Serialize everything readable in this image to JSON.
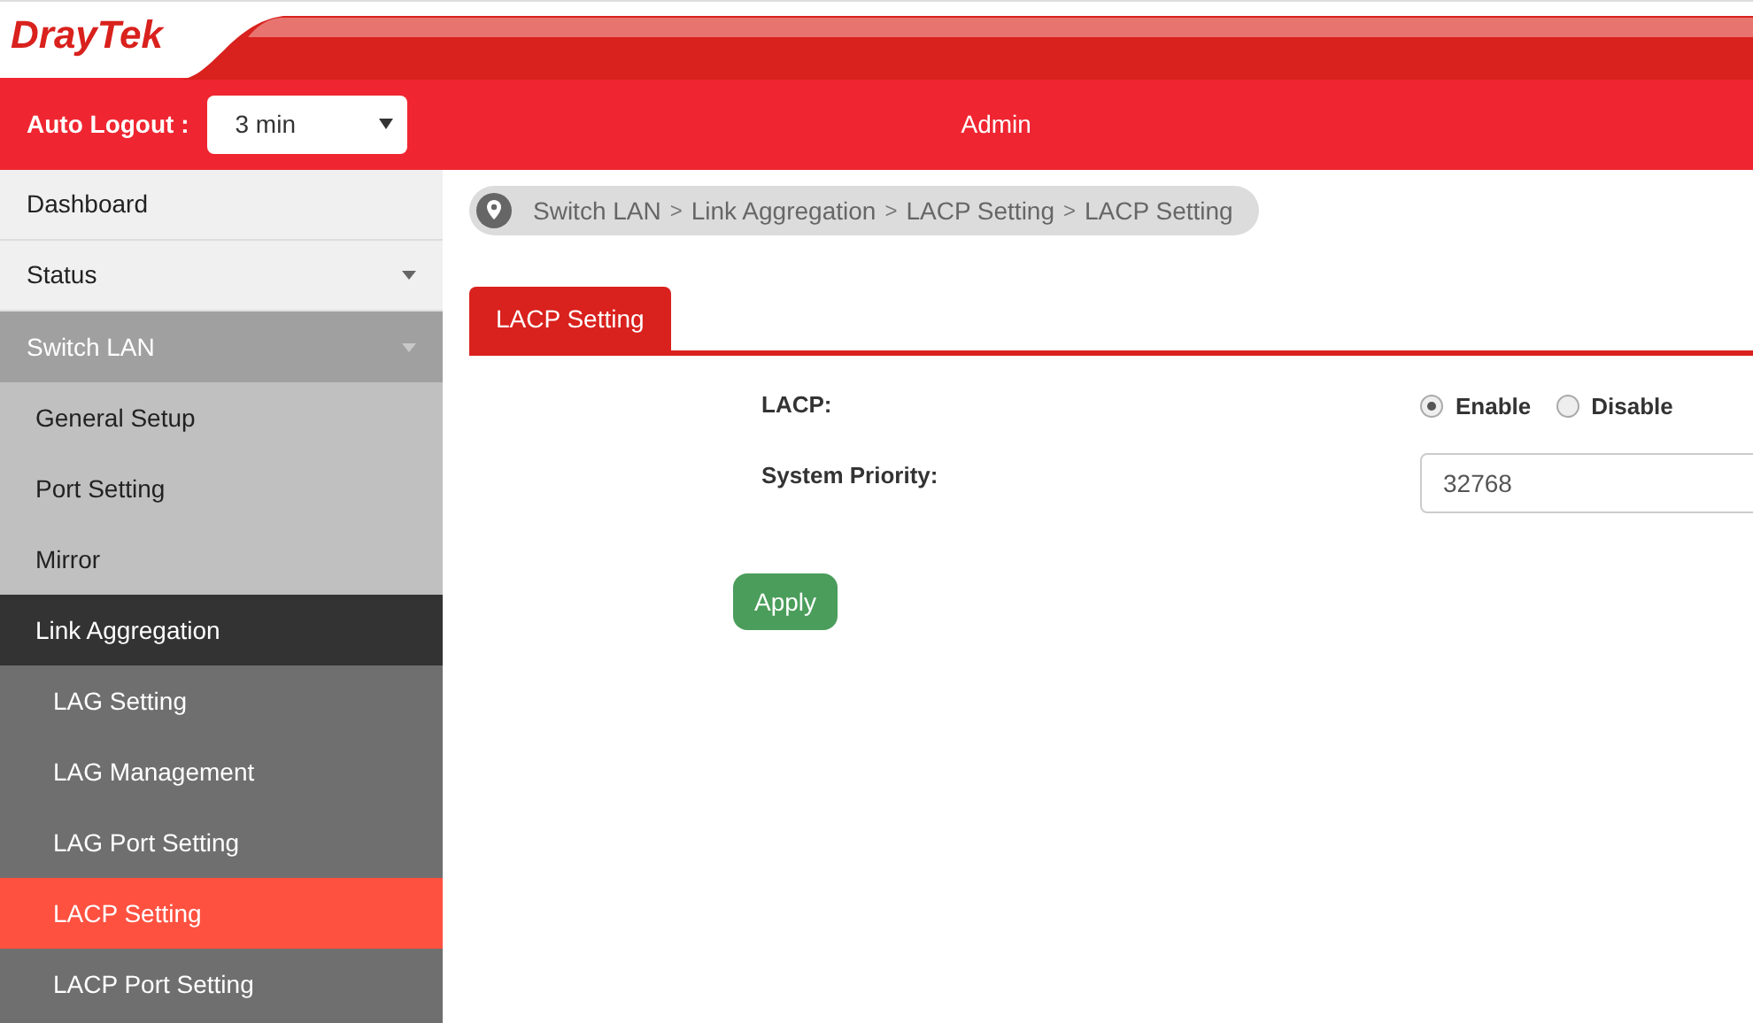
{
  "header": {
    "logo": "DrayTek",
    "auto_logout_label": "Auto Logout :",
    "auto_logout_value": "3 min",
    "user": "Admin"
  },
  "sidebar": {
    "items": [
      {
        "label": "Dashboard",
        "selected": false
      },
      {
        "label": "Status",
        "selected": false,
        "expanded": false
      },
      {
        "label": "Switch LAN",
        "selected": false,
        "expanded": true,
        "children": [
          {
            "label": "General Setup",
            "selected": false
          },
          {
            "label": "Port Setting",
            "selected": false
          },
          {
            "label": "Mirror",
            "selected": false
          },
          {
            "label": "Link Aggregation",
            "selected": false,
            "expanded": true,
            "children": [
              {
                "label": "LAG Setting",
                "selected": false
              },
              {
                "label": "LAG Management",
                "selected": false
              },
              {
                "label": "LAG Port Setting",
                "selected": false
              },
              {
                "label": "LACP Setting",
                "selected": true
              },
              {
                "label": "LACP Port Setting",
                "selected": false
              }
            ]
          }
        ]
      }
    ]
  },
  "breadcrumb": [
    {
      "kind": "crumb",
      "label": "Switch LAN"
    },
    {
      "kind": "separator",
      "label": ">"
    },
    {
      "kind": "crumb",
      "label": "Link Aggregation"
    },
    {
      "kind": "separator",
      "label": ">"
    },
    {
      "kind": "crumb",
      "label": "LACP Setting"
    },
    {
      "kind": "separator",
      "label": ">"
    },
    {
      "kind": "crumb",
      "label": "LACP Setting"
    }
  ],
  "tabs": [
    {
      "label": "LACP Setting",
      "selected": true
    }
  ],
  "form": {
    "lacp_label": "LACP:",
    "lacp_options": [
      {
        "label": "Enable",
        "selected": true
      },
      {
        "label": "Disable",
        "selected": false
      }
    ],
    "priority_label": "System Priority:",
    "priority_value": "32768",
    "apply": "Apply"
  }
}
